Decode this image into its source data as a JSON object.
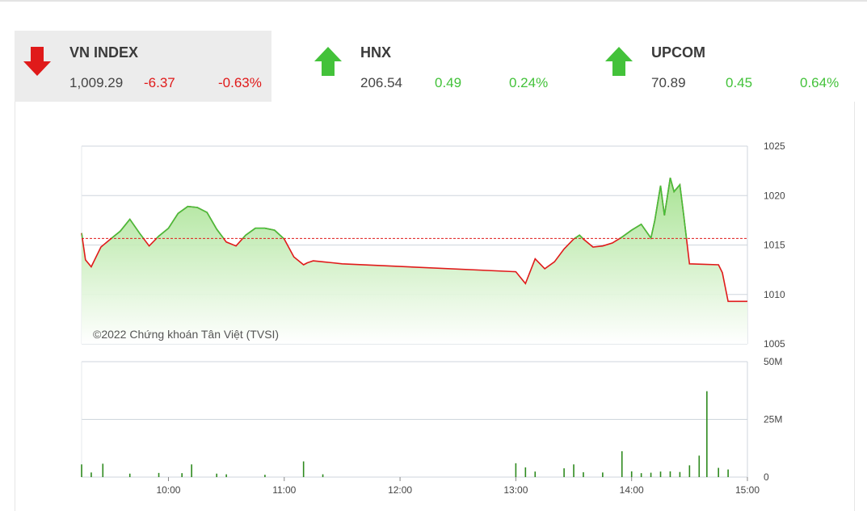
{
  "indices": [
    {
      "name": "VN INDEX",
      "price": "1,009.29",
      "change": "-6.37",
      "percent": "-0.63%",
      "direction": "down",
      "active": true
    },
    {
      "name": "HNX",
      "price": "206.54",
      "change": "0.49",
      "percent": "0.24%",
      "direction": "up",
      "active": false
    },
    {
      "name": "UPCOM",
      "price": "70.89",
      "change": "0.45",
      "percent": "0.64%",
      "direction": "up",
      "active": false
    }
  ],
  "colors": {
    "up": "#43c23a",
    "down": "#e01a1a",
    "area_top": "#9fe088",
    "area_bottom": "#ffffff",
    "volume": "#2e8a1e",
    "reference": "#e01a1a"
  },
  "chart_data": {
    "type": "line",
    "copyright": "©2022 Chứng khoán Tân Việt (TVSI)",
    "reference_value": 1015.66,
    "price": {
      "x": [
        "09:15",
        "09:17",
        "09:20",
        "09:25",
        "09:30",
        "09:35",
        "09:40",
        "09:45",
        "09:50",
        "09:55",
        "10:00",
        "10:05",
        "10:10",
        "10:15",
        "10:20",
        "10:25",
        "10:30",
        "10:35",
        "10:40",
        "10:45",
        "10:50",
        "10:55",
        "11:00",
        "11:05",
        "11:10",
        "11:12",
        "11:15",
        "11:20",
        "11:25",
        "11:30",
        "13:00",
        "13:05",
        "13:10",
        "13:15",
        "13:20",
        "13:25",
        "13:30",
        "13:33",
        "13:35",
        "13:40",
        "13:45",
        "13:50",
        "13:55",
        "14:00",
        "14:05",
        "14:10",
        "14:12",
        "14:15",
        "14:17",
        "14:20",
        "14:22",
        "14:25",
        "14:27",
        "14:30",
        "14:45",
        "14:47",
        "14:50",
        "15:00"
      ],
      "y": [
        1016.2,
        1013.5,
        1012.8,
        1014.8,
        1015.6,
        1016.4,
        1017.6,
        1016.2,
        1014.9,
        1015.9,
        1016.7,
        1018.2,
        1018.9,
        1018.8,
        1018.3,
        1016.6,
        1015.3,
        1014.9,
        1016.0,
        1016.7,
        1016.7,
        1016.5,
        1015.6,
        1013.8,
        1013.0,
        1013.2,
        1013.4,
        1013.3,
        1013.2,
        1013.1,
        1012.3,
        1011.1,
        1013.6,
        1012.6,
        1013.3,
        1014.6,
        1015.6,
        1016.0,
        1015.6,
        1014.8,
        1014.9,
        1015.2,
        1015.8,
        1016.5,
        1017.1,
        1015.7,
        1017.5,
        1021.0,
        1018.0,
        1021.8,
        1020.4,
        1021.1,
        1018.0,
        1013.1,
        1013.0,
        1012.2,
        1009.3,
        1009.3
      ]
    },
    "volume": {
      "x": [
        "09:15",
        "09:20",
        "09:26",
        "09:40",
        "09:55",
        "10:07",
        "10:12",
        "10:25",
        "10:30",
        "10:50",
        "11:10",
        "11:20",
        "13:00",
        "13:05",
        "13:10",
        "13:25",
        "13:30",
        "13:35",
        "13:45",
        "13:55",
        "14:00",
        "14:05",
        "14:10",
        "14:15",
        "14:20",
        "14:25",
        "14:30",
        "14:35",
        "14:39",
        "14:45",
        "14:50"
      ],
      "y": [
        5.5,
        2.0,
        5.8,
        1.5,
        1.8,
        1.7,
        5.5,
        1.5,
        1.2,
        1.0,
        6.8,
        1.2,
        6.0,
        4.2,
        2.4,
        3.8,
        5.5,
        2.1,
        2.0,
        11.2,
        2.5,
        1.7,
        1.9,
        2.4,
        2.5,
        2.2,
        5.1,
        9.3,
        37.2,
        4.0,
        3.3
      ]
    },
    "price_axis": {
      "ylim": [
        1005,
        1025
      ],
      "ticks": [
        "1025",
        "1020",
        "1015",
        "1010",
        "1005"
      ]
    },
    "volume_axis": {
      "ylim": [
        0,
        50
      ],
      "ticks": [
        "50M",
        "25M",
        "0"
      ]
    },
    "x_axis": {
      "range": [
        "09:15",
        "15:00"
      ],
      "ticks": [
        "10:00",
        "11:00",
        "12:00",
        "13:00",
        "14:00",
        "15:00"
      ]
    },
    "grid": true
  }
}
